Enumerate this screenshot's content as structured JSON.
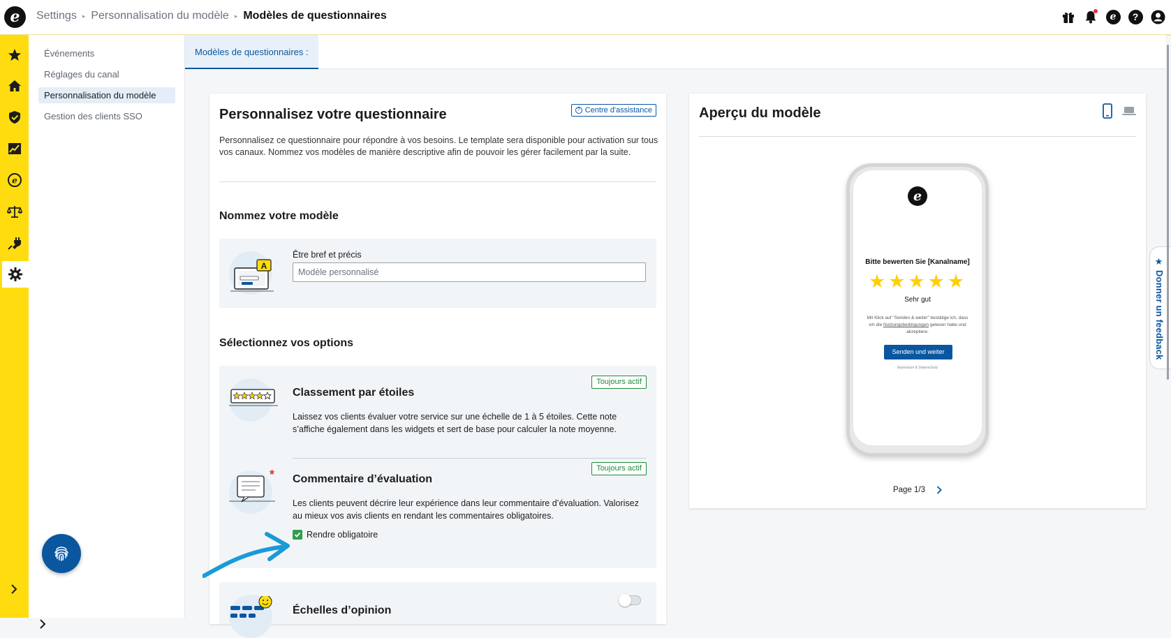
{
  "topbar": {
    "logo_letter": "e",
    "breadcrumb": [
      "Settings",
      "Personnalisation du modèle",
      "Modèles de questionnaires"
    ],
    "icons": [
      "gift-icon",
      "bell-icon",
      "trustedshops-icon",
      "help-icon",
      "account-icon"
    ],
    "help_glyph": "?",
    "trust_glyph": "e"
  },
  "rail": {
    "items": [
      "star-icon",
      "home-icon",
      "shield-icon",
      "chart-icon",
      "trust-icon",
      "scales-icon",
      "plug-icon",
      "gear-icon"
    ],
    "active": "gear-icon",
    "color": "#ffdc0f"
  },
  "subnav": {
    "items": [
      "Événements",
      "Réglages du canal",
      "Personnalisation du modèle",
      "Gestion des clients SSO"
    ],
    "active_index": 2
  },
  "tabs": {
    "active_label": "Modèles de questionnaires :"
  },
  "editor": {
    "title": "Personnalisez votre questionnaire",
    "help_link": "Centre d'assistance",
    "description": "Personnalisez ce questionnaire pour répondre à vos besoins. Le template sera disponible pour activation sur tous vos canaux. Nommez vos modèles de manière descriptive afin de pouvoir les gérer facilement par la suite.",
    "name_section": {
      "heading": "Nommez votre modèle",
      "field_label": "Être bref et précis",
      "field_placeholder": "Modèle personnalisé",
      "field_value": ""
    },
    "options_section": {
      "heading": "Sélectionnez vos options",
      "options": [
        {
          "title": "Classement par étoiles",
          "badge": "Toujours actif",
          "description": "Laissez vos clients évaluer votre service sur une échelle de 1 à 5 étoiles. Cette note s’affiche également dans les widgets et sert de base pour calculer la note moyenne."
        },
        {
          "title": "Commentaire d’évaluation",
          "badge": "Toujours actif",
          "description": "Les clients peuvent décrire leur expérience dans leur commentaire d’évaluation. Valorisez au mieux vos avis clients en rendant les commentaires obligatoires.",
          "checkbox_label": "Rendre obligatoire",
          "checkbox_checked": true
        },
        {
          "title": "Échelles d’opinion",
          "toggle_on": false
        }
      ]
    }
  },
  "preview": {
    "title": "Aperçu du modèle",
    "device_active": "mobile",
    "phone": {
      "logo_letter": "e",
      "question": "Bitte bewerten Sie [Kanalname]",
      "stars": [
        "★",
        "★",
        "★",
        "★",
        "★"
      ],
      "rating_label": "Sehr gut",
      "legal_before": "Mit Klick auf \"Senden & weiter\" bestätige ich, dass ich die",
      "legal_link": "Nutzungsbedingungen",
      "legal_after": "gelesen habe und akzeptiere.",
      "button": "Senden und weiter",
      "footer": "Impressum & Datenschutz"
    },
    "pager": "Page 1/3"
  },
  "feedback_tab": {
    "star": "★",
    "label": "Donner un feedback"
  },
  "colors": {
    "accent": "#0a57a0",
    "rail": "#ffdc0f",
    "star": "#ffcf06",
    "success": "#1f8a3a"
  }
}
